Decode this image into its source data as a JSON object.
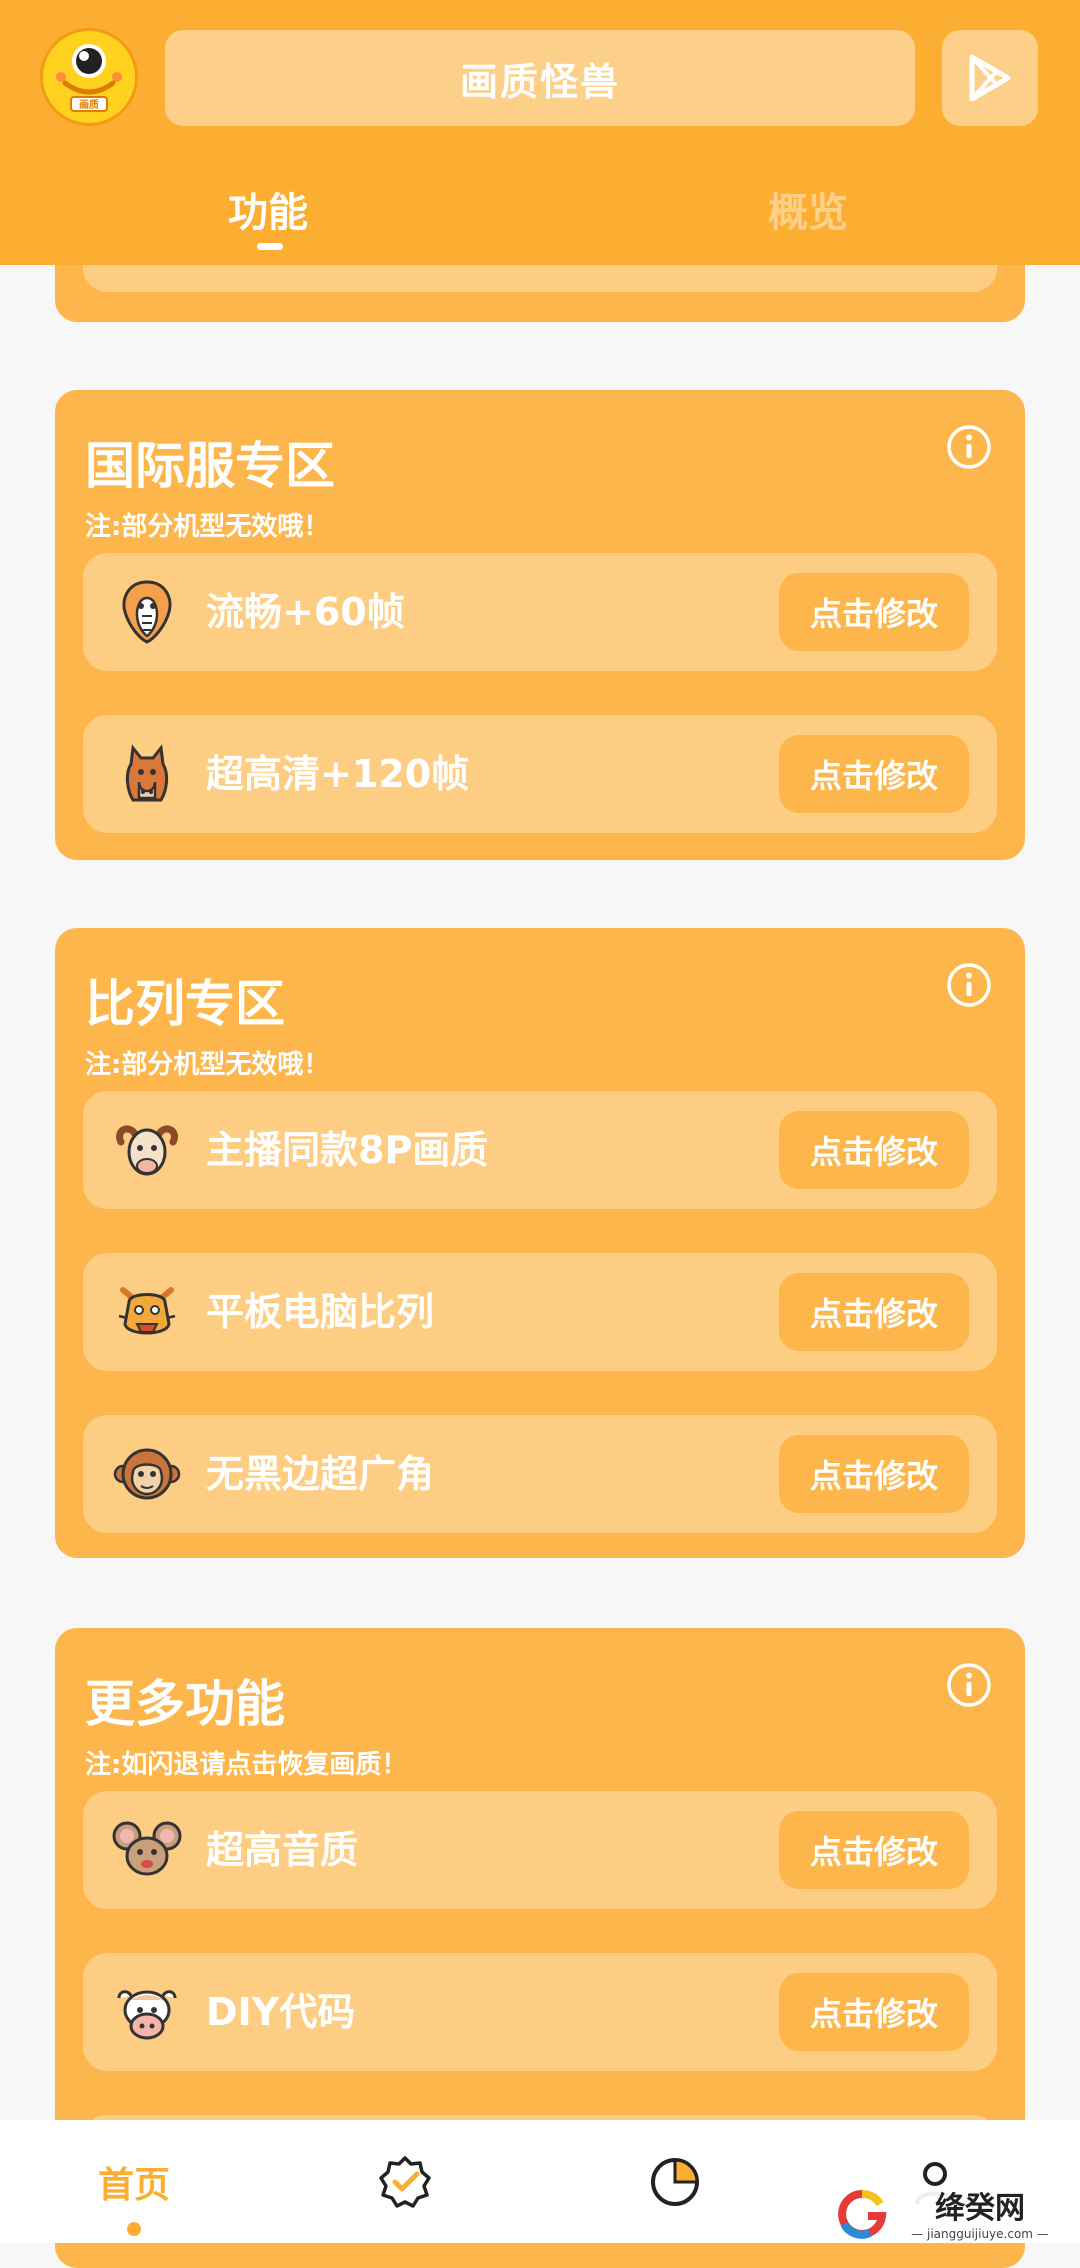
{
  "header": {
    "title": "画质怪兽",
    "tabs": [
      {
        "label": "功能",
        "active": true
      },
      {
        "label": "概览",
        "active": false
      }
    ],
    "avatar_badge": "画质"
  },
  "sections": [
    {
      "title": "国际服专区",
      "note": "注:部分机型无效哦！",
      "rows": [
        {
          "icon": "cobra-icon",
          "label": "流畅+60帧",
          "button": "点击修改"
        },
        {
          "icon": "horse-icon",
          "label": "超高清+120帧",
          "button": "点击修改"
        }
      ]
    },
    {
      "title": "比列专区",
      "note": "注:部分机型无效哦！",
      "rows": [
        {
          "icon": "ram-icon",
          "label": "主播同款8P画质",
          "button": "点击修改"
        },
        {
          "icon": "dragon-icon",
          "label": "平板电脑比列",
          "button": "点击修改"
        },
        {
          "icon": "monkey-icon",
          "label": "无黑边超广角",
          "button": "点击修改"
        }
      ]
    },
    {
      "title": "更多功能",
      "note": "注:如闪退请点击恢复画质！",
      "rows": [
        {
          "icon": "mouse-icon",
          "label": "超高音质",
          "button": "点击修改"
        },
        {
          "icon": "ox-icon",
          "label": "DIY代码",
          "button": "点击修改"
        }
      ]
    }
  ],
  "bottom_nav": {
    "items": [
      {
        "label": "首页",
        "icon": "home-indicator",
        "active": true
      },
      {
        "label": "",
        "icon": "verified-badge-icon",
        "active": false
      },
      {
        "label": "",
        "icon": "pie-chart-icon",
        "active": false
      },
      {
        "label": "",
        "icon": "profile-icon",
        "active": false
      }
    ]
  },
  "watermark": {
    "name": "绛癸网",
    "url": "— jiangguijiuye.com —"
  },
  "colors": {
    "primary": "#fcae32",
    "card": "#fcb64b",
    "row": "#fdcd83",
    "tint": "#fdd089"
  }
}
